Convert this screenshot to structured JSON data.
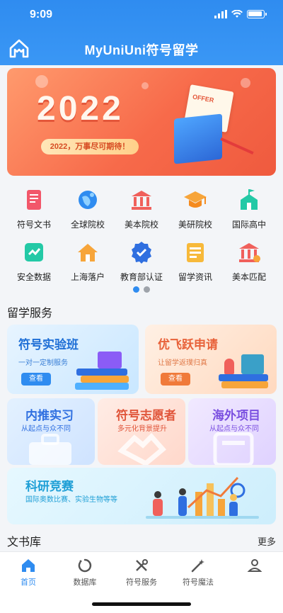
{
  "status": {
    "time": "9:09"
  },
  "header": {
    "title": "MyUniUni符号留学"
  },
  "banner": {
    "year": "2022",
    "slogan": "2022，万事尽可期待！",
    "paper_text": "OFFER"
  },
  "grid": [
    {
      "label": "符号文书",
      "icon": "scroll-icon",
      "color": "#f2576a"
    },
    {
      "label": "全球院校",
      "icon": "globe-icon",
      "color": "#2f8cf0"
    },
    {
      "label": "美本院校",
      "icon": "bank-building-icon",
      "color": "#f0605b"
    },
    {
      "label": "美研院校",
      "icon": "graduation-cap-icon",
      "color": "#f7a53a"
    },
    {
      "label": "国际高中",
      "icon": "school-icon",
      "color": "#23c9a6"
    },
    {
      "label": "安全数据",
      "icon": "shield-data-icon",
      "color": "#23c9a6"
    },
    {
      "label": "上海落户",
      "icon": "house-icon",
      "color": "#f7a53a"
    },
    {
      "label": "教育部认证",
      "icon": "certified-badge-icon",
      "color": "#2f8cf0"
    },
    {
      "label": "留学资讯",
      "icon": "news-icon",
      "color": "#f7b93a"
    },
    {
      "label": "美本匹配",
      "icon": "match-building-icon",
      "color": "#f0605b"
    }
  ],
  "services": {
    "title": "留学服务",
    "card1": {
      "title": "符号实验班",
      "sub": "一对一定制服务",
      "btn": "查看",
      "color": "#2f8cf0"
    },
    "card2": {
      "title": "优飞跃申请",
      "sub": "让留学返璞归真",
      "btn": "查看",
      "color": "#f07a3a"
    },
    "card3": {
      "title": "内推实习",
      "sub": "从起点与众不同",
      "color": "#2f6fe0"
    },
    "card4": {
      "title": "符号志愿者",
      "sub": "多元化背景提升",
      "color": "#e8553a"
    },
    "card5": {
      "title": "海外项目",
      "sub": "从起点与众不同",
      "color": "#7a4fe0"
    },
    "card6": {
      "title": "科研竞赛",
      "sub": "国际奥数比赛、实验生物等等",
      "color": "#1f9fd6"
    }
  },
  "library": {
    "title": "文书库",
    "more": "更多"
  },
  "tabs": [
    {
      "label": "首页",
      "icon": "home-icon",
      "active": true
    },
    {
      "label": "数据库",
      "icon": "database-icon",
      "active": false
    },
    {
      "label": "符号服务",
      "icon": "tools-icon",
      "active": false
    },
    {
      "label": "符号魔法",
      "icon": "magic-wand-icon",
      "active": false
    },
    {
      "label": "",
      "icon": "user-icon",
      "active": false
    }
  ]
}
